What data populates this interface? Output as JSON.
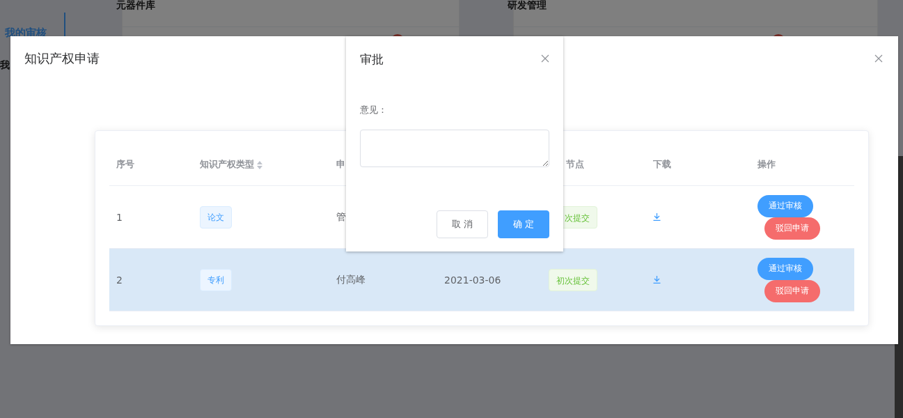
{
  "background": {
    "sidebar": [
      {
        "label": "我的审核",
        "selected": true
      },
      {
        "label": "我",
        "selected": false
      }
    ],
    "cards": [
      {
        "title": "元器件库"
      },
      {
        "title": "研发管理"
      }
    ]
  },
  "dialog": {
    "title": "知识产权申请",
    "table": {
      "columns": [
        {
          "label": "序号",
          "sortable": false
        },
        {
          "label": "知识产权类型",
          "sortable": true
        },
        {
          "label": "申"
        },
        {
          "label": "节点",
          "sortable": false
        },
        {
          "label": "下载",
          "sortable": false
        },
        {
          "label": "操作",
          "sortable": false
        }
      ],
      "rows": [
        {
          "index": "1",
          "type": "论文",
          "applicant": "管",
          "status": "次提交",
          "selected": false,
          "actions": [
            "通过审核",
            "驳回申请"
          ]
        },
        {
          "index": "2",
          "type": "专利",
          "applicant": "付高峰",
          "date": "2021-03-06",
          "status": "初次提交",
          "selected": true,
          "actions": [
            "通过审核",
            "驳回申请"
          ]
        }
      ]
    }
  },
  "approval": {
    "title": "审批",
    "label": "意见：",
    "buttons": [
      {
        "label": "取 消",
        "kind": "default"
      },
      {
        "label": "确 定",
        "kind": "primary"
      }
    ]
  }
}
